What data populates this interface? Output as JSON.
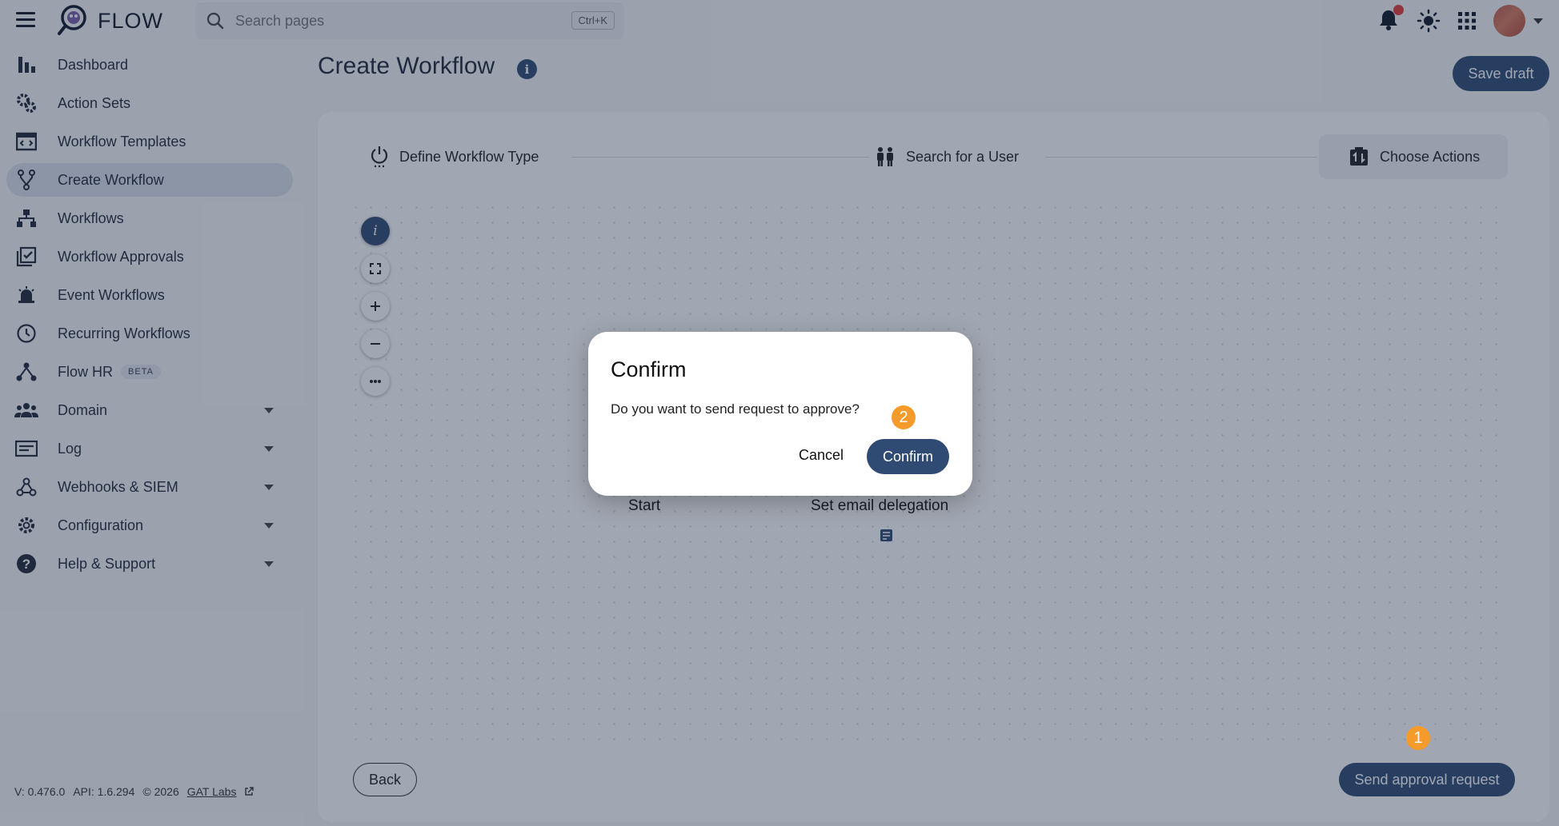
{
  "header": {
    "app_name": "FLOW",
    "search_placeholder": "Search pages",
    "search_shortcut": "Ctrl+K"
  },
  "sidebar": {
    "items": [
      {
        "label": "Dashboard",
        "icon": "bar-chart-icon"
      },
      {
        "label": "Action Sets",
        "icon": "gears-icon"
      },
      {
        "label": "Workflow Templates",
        "icon": "template-icon"
      },
      {
        "label": "Create Workflow",
        "icon": "fork-icon",
        "active": true
      },
      {
        "label": "Workflows",
        "icon": "hierarchy-icon"
      },
      {
        "label": "Workflow Approvals",
        "icon": "approval-check-icon"
      },
      {
        "label": "Event Workflows",
        "icon": "alarm-icon"
      },
      {
        "label": "Recurring Workflows",
        "icon": "clock-icon"
      },
      {
        "label": "Flow HR",
        "icon": "people-network-icon",
        "badge": "BETA"
      },
      {
        "label": "Domain",
        "icon": "group-icon",
        "expandable": true
      },
      {
        "label": "Log",
        "icon": "log-icon",
        "expandable": true
      },
      {
        "label": "Webhooks & SIEM",
        "icon": "webhook-icon",
        "expandable": true
      },
      {
        "label": "Configuration",
        "icon": "gear-icon",
        "expandable": true
      },
      {
        "label": "Help & Support",
        "icon": "help-icon",
        "expandable": true
      }
    ]
  },
  "footer": {
    "version": "V: 0.476.0",
    "api": "API: 1.6.294",
    "copyright": "© 2026",
    "company_link": "GAT Labs"
  },
  "main": {
    "title": "Create Workflow",
    "save_draft_label": "Save draft",
    "steps": [
      {
        "label": "Define Workflow Type",
        "icon": "power-icon"
      },
      {
        "label": "Search for a User",
        "icon": "users-icon"
      },
      {
        "label": "Choose Actions",
        "icon": "actions-icon",
        "active": true
      }
    ],
    "canvas": {
      "nodes": [
        "Start",
        "Set email delegation"
      ]
    },
    "back_label": "Back",
    "send_label": "Send approval request"
  },
  "dialog": {
    "title": "Confirm",
    "message": "Do you want to send request to approve?",
    "cancel_label": "Cancel",
    "confirm_label": "Confirm"
  },
  "annotations": {
    "badge_1": "1",
    "badge_2": "2"
  },
  "colors": {
    "primary": "#2f4a73",
    "badge": "#f59b2b",
    "notification": "#e53935"
  }
}
